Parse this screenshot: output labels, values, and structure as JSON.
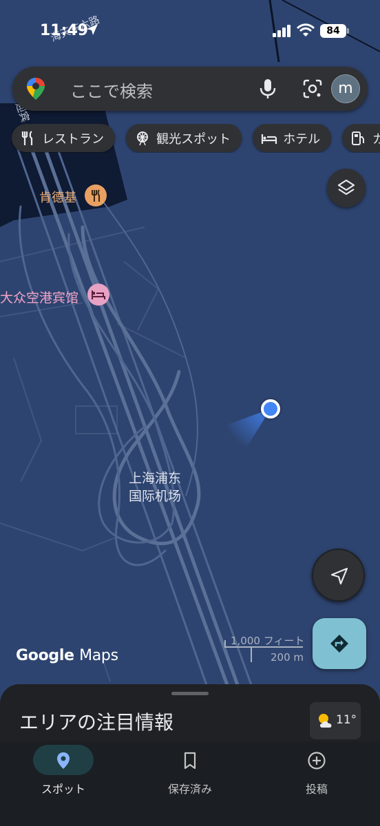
{
  "status_bar": {
    "time": "11:49",
    "battery": "84"
  },
  "search": {
    "placeholder": "ここで検索",
    "avatar_letter": "m"
  },
  "chips": [
    {
      "label": "レストラン",
      "icon": "fork-knife-icon"
    },
    {
      "label": "観光スポット",
      "icon": "ferris-wheel-icon"
    },
    {
      "label": "ホテル",
      "icon": "bed-icon"
    },
    {
      "label": "ガ",
      "icon": "gas-pump-icon"
    }
  ],
  "map": {
    "road_label_1": "海天东六路",
    "road_label_2": "迎宾",
    "poi_restaurant": "肯德基",
    "poi_hotel": "大众空港宾馆",
    "airport_line1": "上海浦东",
    "airport_line2": "国际机场"
  },
  "scale": {
    "feet": "1,000 フィート",
    "meters": "200 m"
  },
  "logo": {
    "google": "Google",
    "maps": "Maps"
  },
  "sheet": {
    "title": "エリアの注目情報",
    "weather_temp": "11°"
  },
  "bottom_nav": [
    {
      "label": "スポット",
      "icon": "place-pin-icon",
      "active": true
    },
    {
      "label": "保存済み",
      "icon": "bookmark-icon",
      "active": false
    },
    {
      "label": "投稿",
      "icon": "add-circle-icon",
      "active": false
    }
  ],
  "colors": {
    "map_background": "#2e4470",
    "accent_blue": "#4285f4",
    "directions_button": "#7fc1d2"
  }
}
